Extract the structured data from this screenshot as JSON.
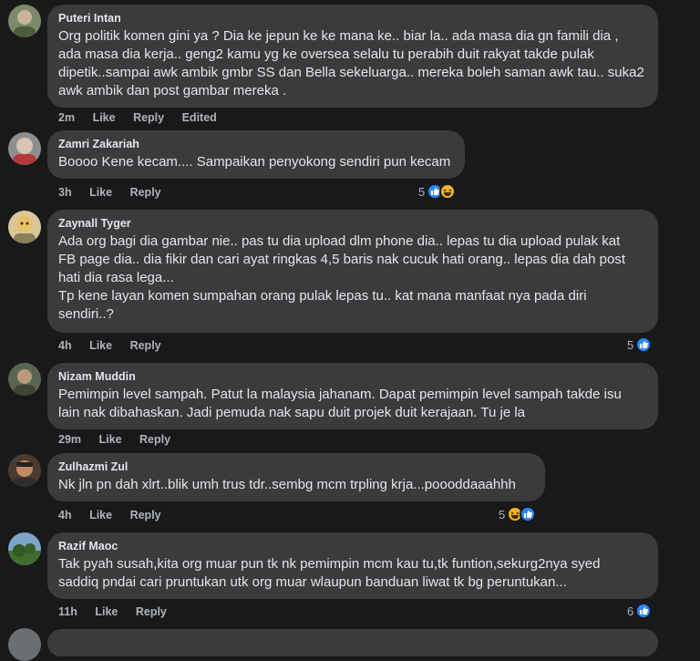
{
  "comments": [
    {
      "author": "Puteri Intan",
      "lines": [
        "Org politik komen gini ya ? Dia ke jepun ke ke mana ke.. biar la.. ada masa dia gn famili dia ,",
        "ada masa dia kerja.. geng2 kamu yg ke oversea selalu tu perabih duit rakyat takde pulak",
        "dipetik..sampai awk ambik gmbr SS dan Bella sekeluarga.. mereka boleh saman awk tau.. suka2",
        "awk ambik dan post gambar mereka ."
      ],
      "time": "2m",
      "like": "Like",
      "reply": "Reply",
      "edited": "Edited",
      "reaction_count": ""
    },
    {
      "author": "Zamri Zakariah",
      "lines": [
        "Boooo Kene kecam.... Sampaikan penyokong sendiri pun kecam"
      ],
      "time": "3h",
      "like": "Like",
      "reply": "Reply",
      "reaction_count": "5"
    },
    {
      "author": "Zaynall Tyger",
      "lines": [
        "Ada org bagi dia gambar nie.. pas tu dia upload dlm phone dia.. lepas tu dia upload pulak kat",
        "FB page dia.. dia fikir dan cari ayat ringkas 4,5 baris nak cucuk hati orang.. lepas dia dah post",
        "hati dia rasa lega...",
        "Tp kene layan komen sumpahan orang pulak lepas tu.. kat mana manfaat nya pada diri",
        "sendiri..?"
      ],
      "time": "4h",
      "like": "Like",
      "reply": "Reply",
      "reaction_count": "5"
    },
    {
      "author": "Nizam Muddin",
      "lines": [
        "Pemimpin level sampah. Patut la malaysia jahanam. Dapat pemimpin level sampah takde isu",
        "lain nak dibahaskan. Jadi pemuda nak sapu duit projek duit kerajaan. Tu je la"
      ],
      "time": "29m",
      "like": "Like",
      "reply": "Reply",
      "reaction_count": ""
    },
    {
      "author": "Zulhazmi Zul",
      "lines": [
        "Nk jln pn dah xlrt..blik umh trus tdr..sembg mcm trpling krja...poooddaaahhh"
      ],
      "time": "4h",
      "like": "Like",
      "reply": "Reply",
      "reaction_count": "5"
    },
    {
      "author": "Razif Maoc",
      "lines": [
        "Tak pyah susah,kita org muar pun tk nk pemimpin mcm kau tu,tk funtion,sekurg2nya syed",
        "saddiq pndai cari pruntukan utk org muar wlaupun banduan liwat tk bg peruntukan..."
      ],
      "time": "11h",
      "like": "Like",
      "reply": "Reply",
      "reaction_count": "6"
    }
  ],
  "colors": {
    "background": "#18191a",
    "bubble": "#3a3b3c",
    "text": "#e4e6eb",
    "secondary": "#b0b3b8",
    "like_blue": "#2d88ff",
    "haha_yellow": "#f7b125"
  },
  "icons": {
    "like": "like-reaction-icon",
    "haha": "haha-reaction-icon"
  }
}
